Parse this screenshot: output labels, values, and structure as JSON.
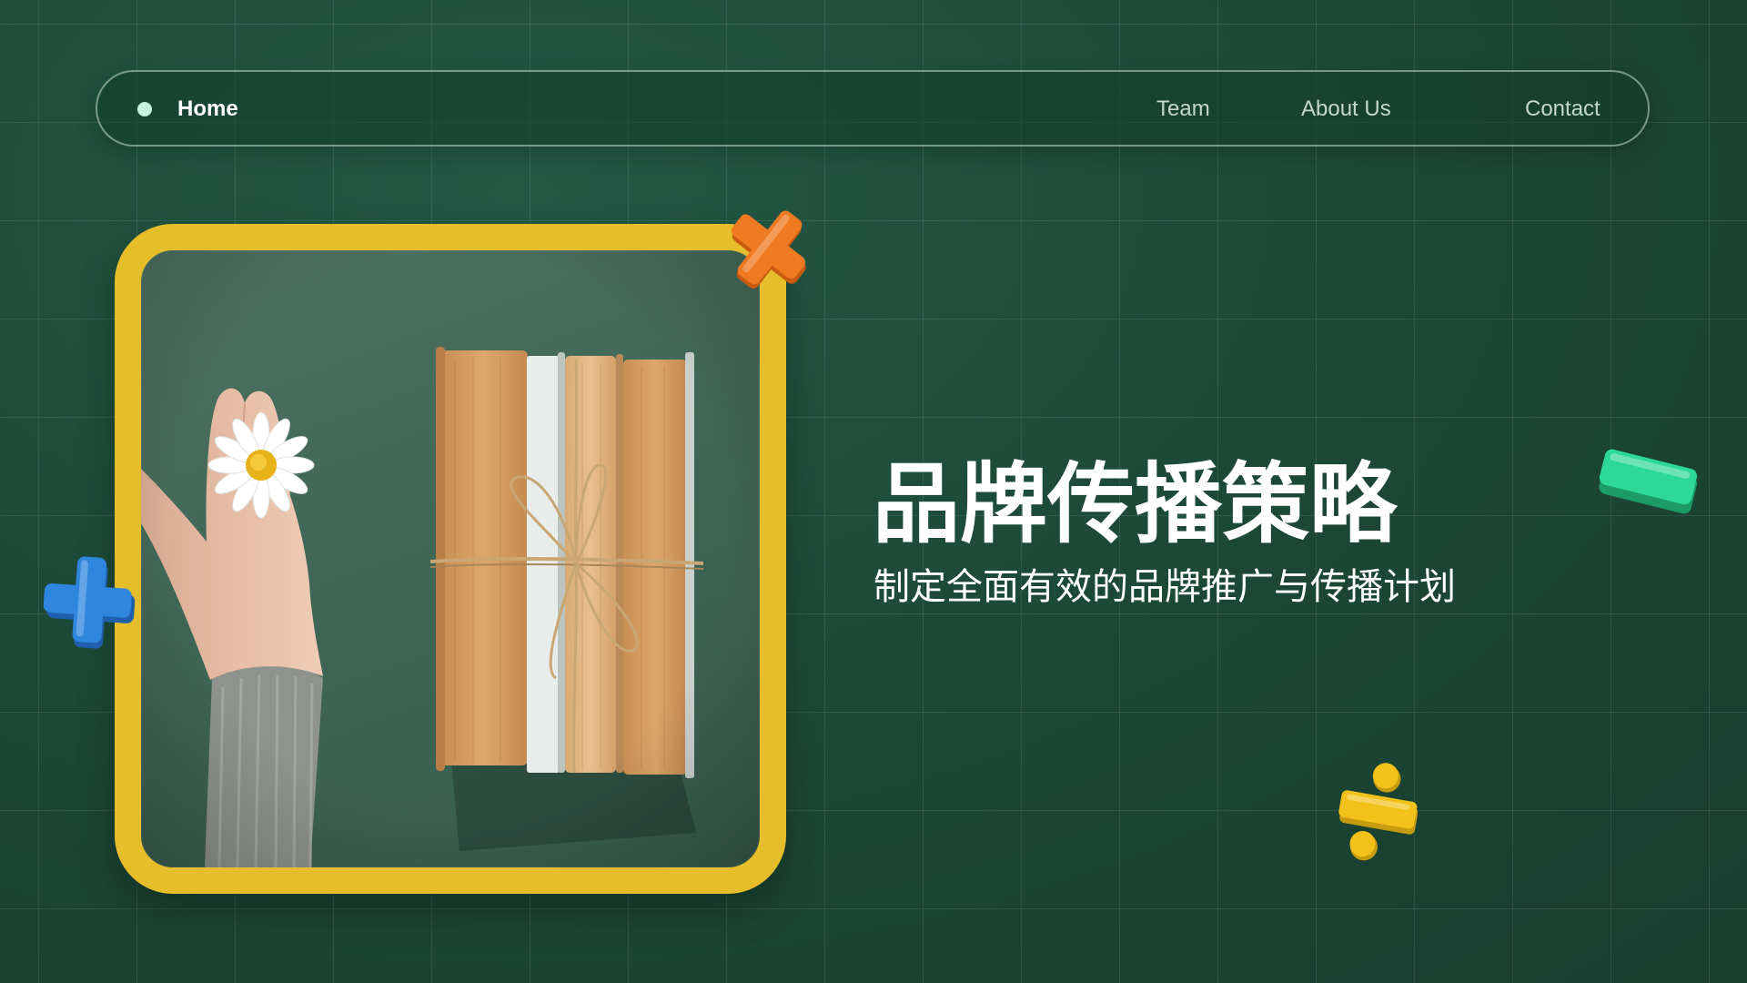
{
  "nav": {
    "home_label": "Home",
    "items": [
      {
        "label": "Team"
      },
      {
        "label": "About Us"
      },
      {
        "label": "Contact"
      }
    ]
  },
  "hero": {
    "title": "品牌传播策略",
    "subtitle": "制定全面有效的品牌推广与传播计划"
  },
  "icons": {
    "nav_dot": "dot-icon",
    "orange": "multiply-icon",
    "blue": "plus-icon",
    "green": "minus-icon",
    "yellow": "divide-icon"
  },
  "colors": {
    "background": "#1d4a38",
    "frame_border": "#e6bd2a",
    "orange_accent": "#f07a22",
    "blue_accent": "#2f86de",
    "green_accent": "#2ed89a",
    "yellow_accent": "#f2c21b",
    "nav_dot": "#c6f0df"
  }
}
